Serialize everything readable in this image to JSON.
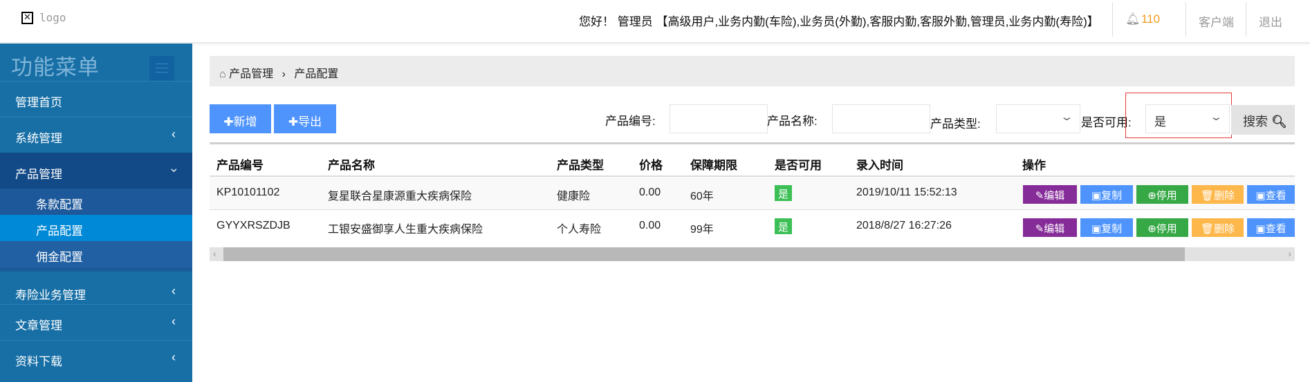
{
  "header": {
    "logo": "logo",
    "greeting": "您好！ 管理员 【高级用户,业务内勤(车险),业务员(外勤),客服内勤,客服外勤,管理员,业务内勤(寿险)】",
    "notification_count": "110",
    "client_link": "客户端",
    "logout_link": "退出"
  },
  "sidebar": {
    "title": "功能菜单",
    "items": [
      {
        "label": "管理首页"
      },
      {
        "label": "系统管理"
      },
      {
        "label": "产品管理"
      },
      {
        "label": "寿险业务管理"
      },
      {
        "label": "文章管理"
      },
      {
        "label": "资料下载"
      }
    ],
    "subitems": [
      {
        "label": "条款配置"
      },
      {
        "label": "产品配置"
      },
      {
        "label": "佣金配置"
      }
    ]
  },
  "breadcrumb": {
    "root": "产品管理",
    "current": "产品配置"
  },
  "toolbar": {
    "add": "新增",
    "export": "导出"
  },
  "filters": {
    "code_label": "产品编号:",
    "name_label": "产品名称:",
    "type_label": "产品类型:",
    "available_label": "是否可用:",
    "available_value": "是",
    "search": "搜索"
  },
  "table": {
    "headers": [
      "产品编号",
      "产品名称",
      "产品类型",
      "价格",
      "保障期限",
      "是否可用",
      "录入时间",
      "操作"
    ],
    "rows": [
      {
        "code": "KP10101102",
        "name": "复星联合星康源重大疾病保险",
        "type": "健康险",
        "price": "0.00",
        "term": "60年",
        "available": "是",
        "time": "2019/10/11 15:52:13"
      },
      {
        "code": "GYYXRSZDJB",
        "name": "工银安盛御享人生重大疾病保险",
        "type": "个人寿险",
        "price": "0.00",
        "term": "99年",
        "available": "是",
        "time": "2018/8/27 16:27:26"
      }
    ],
    "actions": {
      "edit": "编辑",
      "copy": "复制",
      "disable": "停用",
      "delete": "删除",
      "view": "查看"
    }
  },
  "colors": {
    "sidebar": "#176fa6",
    "active": "#0089d6",
    "primary": "#4f94fd",
    "purple": "#862c99",
    "green": "#37a846",
    "orange": "#feb74a"
  }
}
